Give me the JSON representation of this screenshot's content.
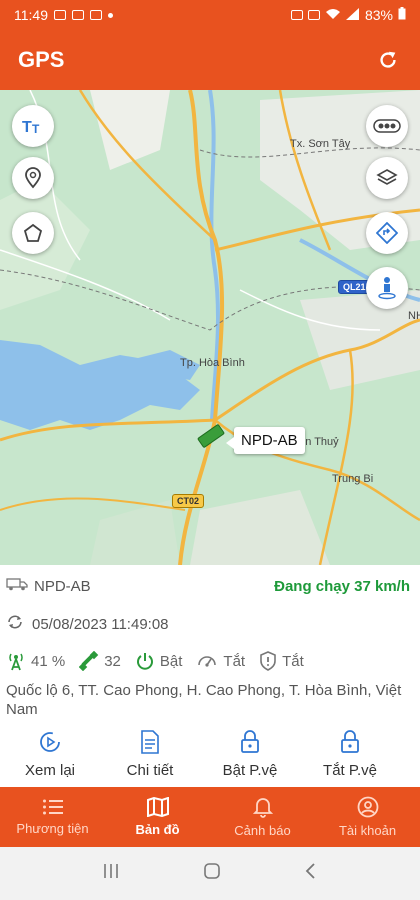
{
  "status_bar": {
    "time": "11:49",
    "battery": "83%"
  },
  "app_bar": {
    "title": "GPS"
  },
  "map": {
    "labels": {
      "son_tay": "Tx. Sơn Tây",
      "hoa_binh": "Tp. Hòa Bình",
      "son_thuy": "ơn Thuỷ",
      "trung_bi": "Trung Bi",
      "ct02": "CT02",
      "ql21": "QL21",
      "nh": "NH"
    },
    "vehicle_label": "NPD-AB",
    "buttons": [
      "text-size",
      "location-pin",
      "polygon",
      "toggle",
      "layers",
      "directions",
      "street-view"
    ]
  },
  "info": {
    "plate": "NPD-AB",
    "status": "Đang chạy 37 km/h",
    "datetime": "05/08/2023 11:49:08",
    "signal": "41 %",
    "satellites": "32",
    "engine": "Bật",
    "ac": "Tắt",
    "security": "Tắt",
    "address": "Quốc lộ 6, TT. Cao Phong, H. Cao Phong, T. Hòa Bình, Việt Nam"
  },
  "actions": [
    {
      "label": "Xem lại"
    },
    {
      "label": "Chi tiết"
    },
    {
      "label": "Bật P.vệ"
    },
    {
      "label": "Tắt P.vệ"
    }
  ],
  "bottom_nav": [
    {
      "label": "Phương tiện"
    },
    {
      "label": "Bản đồ"
    },
    {
      "label": "Cảnh báo"
    },
    {
      "label": "Tài khoản"
    }
  ],
  "colors": {
    "brand": "#e8521f",
    "running": "#1e9a3a"
  }
}
